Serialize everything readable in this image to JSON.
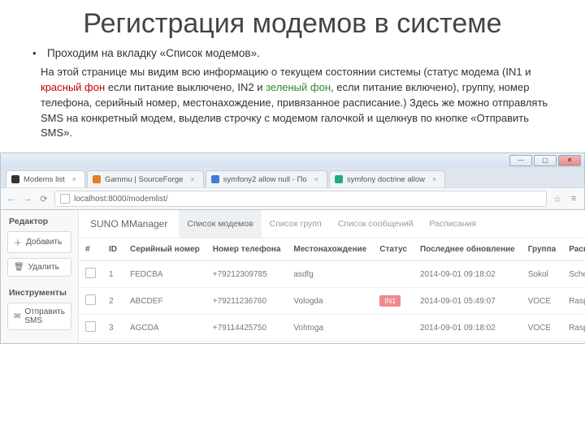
{
  "title": "Регистрация модемов в системе",
  "bullet": "Проходим на вкладку «Список модемов».",
  "paragraph": {
    "p1": "На этой странице мы видим всю информацию о текущем состоянии системы (статус модема (IN1 и ",
    "red": "красный фон",
    "p2": " если питание выключено, IN2 и ",
    "green": "зеленый фон",
    "p3": ", если питание включено), группу, номер телефона, серийный номер, местонахождение, привязанное расписание.) Здесь же можно отправлять SMS на конкретный модем, выделив строчку с модемом галочкой и щелкнув по кнопке «Отправить SMS»."
  },
  "browser": {
    "tabs": [
      {
        "label": "Modems list",
        "icon": "dark"
      },
      {
        "label": "Gammu | SourceForge",
        "icon": "orange"
      },
      {
        "label": "symfony2 allow null - По",
        "icon": "blue"
      },
      {
        "label": "symfony doctrine allow",
        "icon": "green"
      }
    ],
    "url": "localhost:8000/modemlist/"
  },
  "app": {
    "brand": "SUNO MManager",
    "nav": [
      "Список модемов",
      "Список групп",
      "Список сообщений",
      "Расписания"
    ],
    "side_editor_title": "Редактор",
    "side_tools_title": "Инструменты",
    "btn_add": "Добавить",
    "btn_del": "Удалить",
    "btn_sms": "Отправить SMS",
    "cols": {
      "c0": "#",
      "c1": "ID",
      "c2": "Серийный номер",
      "c3": "Номер телефона",
      "c4": "Местонахождение",
      "c5": "Статус",
      "c6": "Последнее обновление",
      "c7": "Группа",
      "c8": "Расписание"
    },
    "rows": [
      {
        "id": "1",
        "serial": "FEDCBA",
        "phone": "+79212309785",
        "loc": "asdfg",
        "status": "",
        "updated": "2014-09-01 09:18:02",
        "group": "Sokol",
        "sched": "Schedule"
      },
      {
        "id": "2",
        "serial": "ABCDEF",
        "phone": "+79211236760",
        "loc": "Vologda",
        "status": "IN1",
        "updated": "2014-09-01 05:49:07",
        "group": "VOCE",
        "sched": "Raspisanie"
      },
      {
        "id": "3",
        "serial": "AGCDA",
        "phone": "+79114425750",
        "loc": "Vohtoga",
        "status": "",
        "updated": "2014-09-01 09:18:02",
        "group": "VOCE",
        "sched": "Raspisanie"
      }
    ]
  }
}
